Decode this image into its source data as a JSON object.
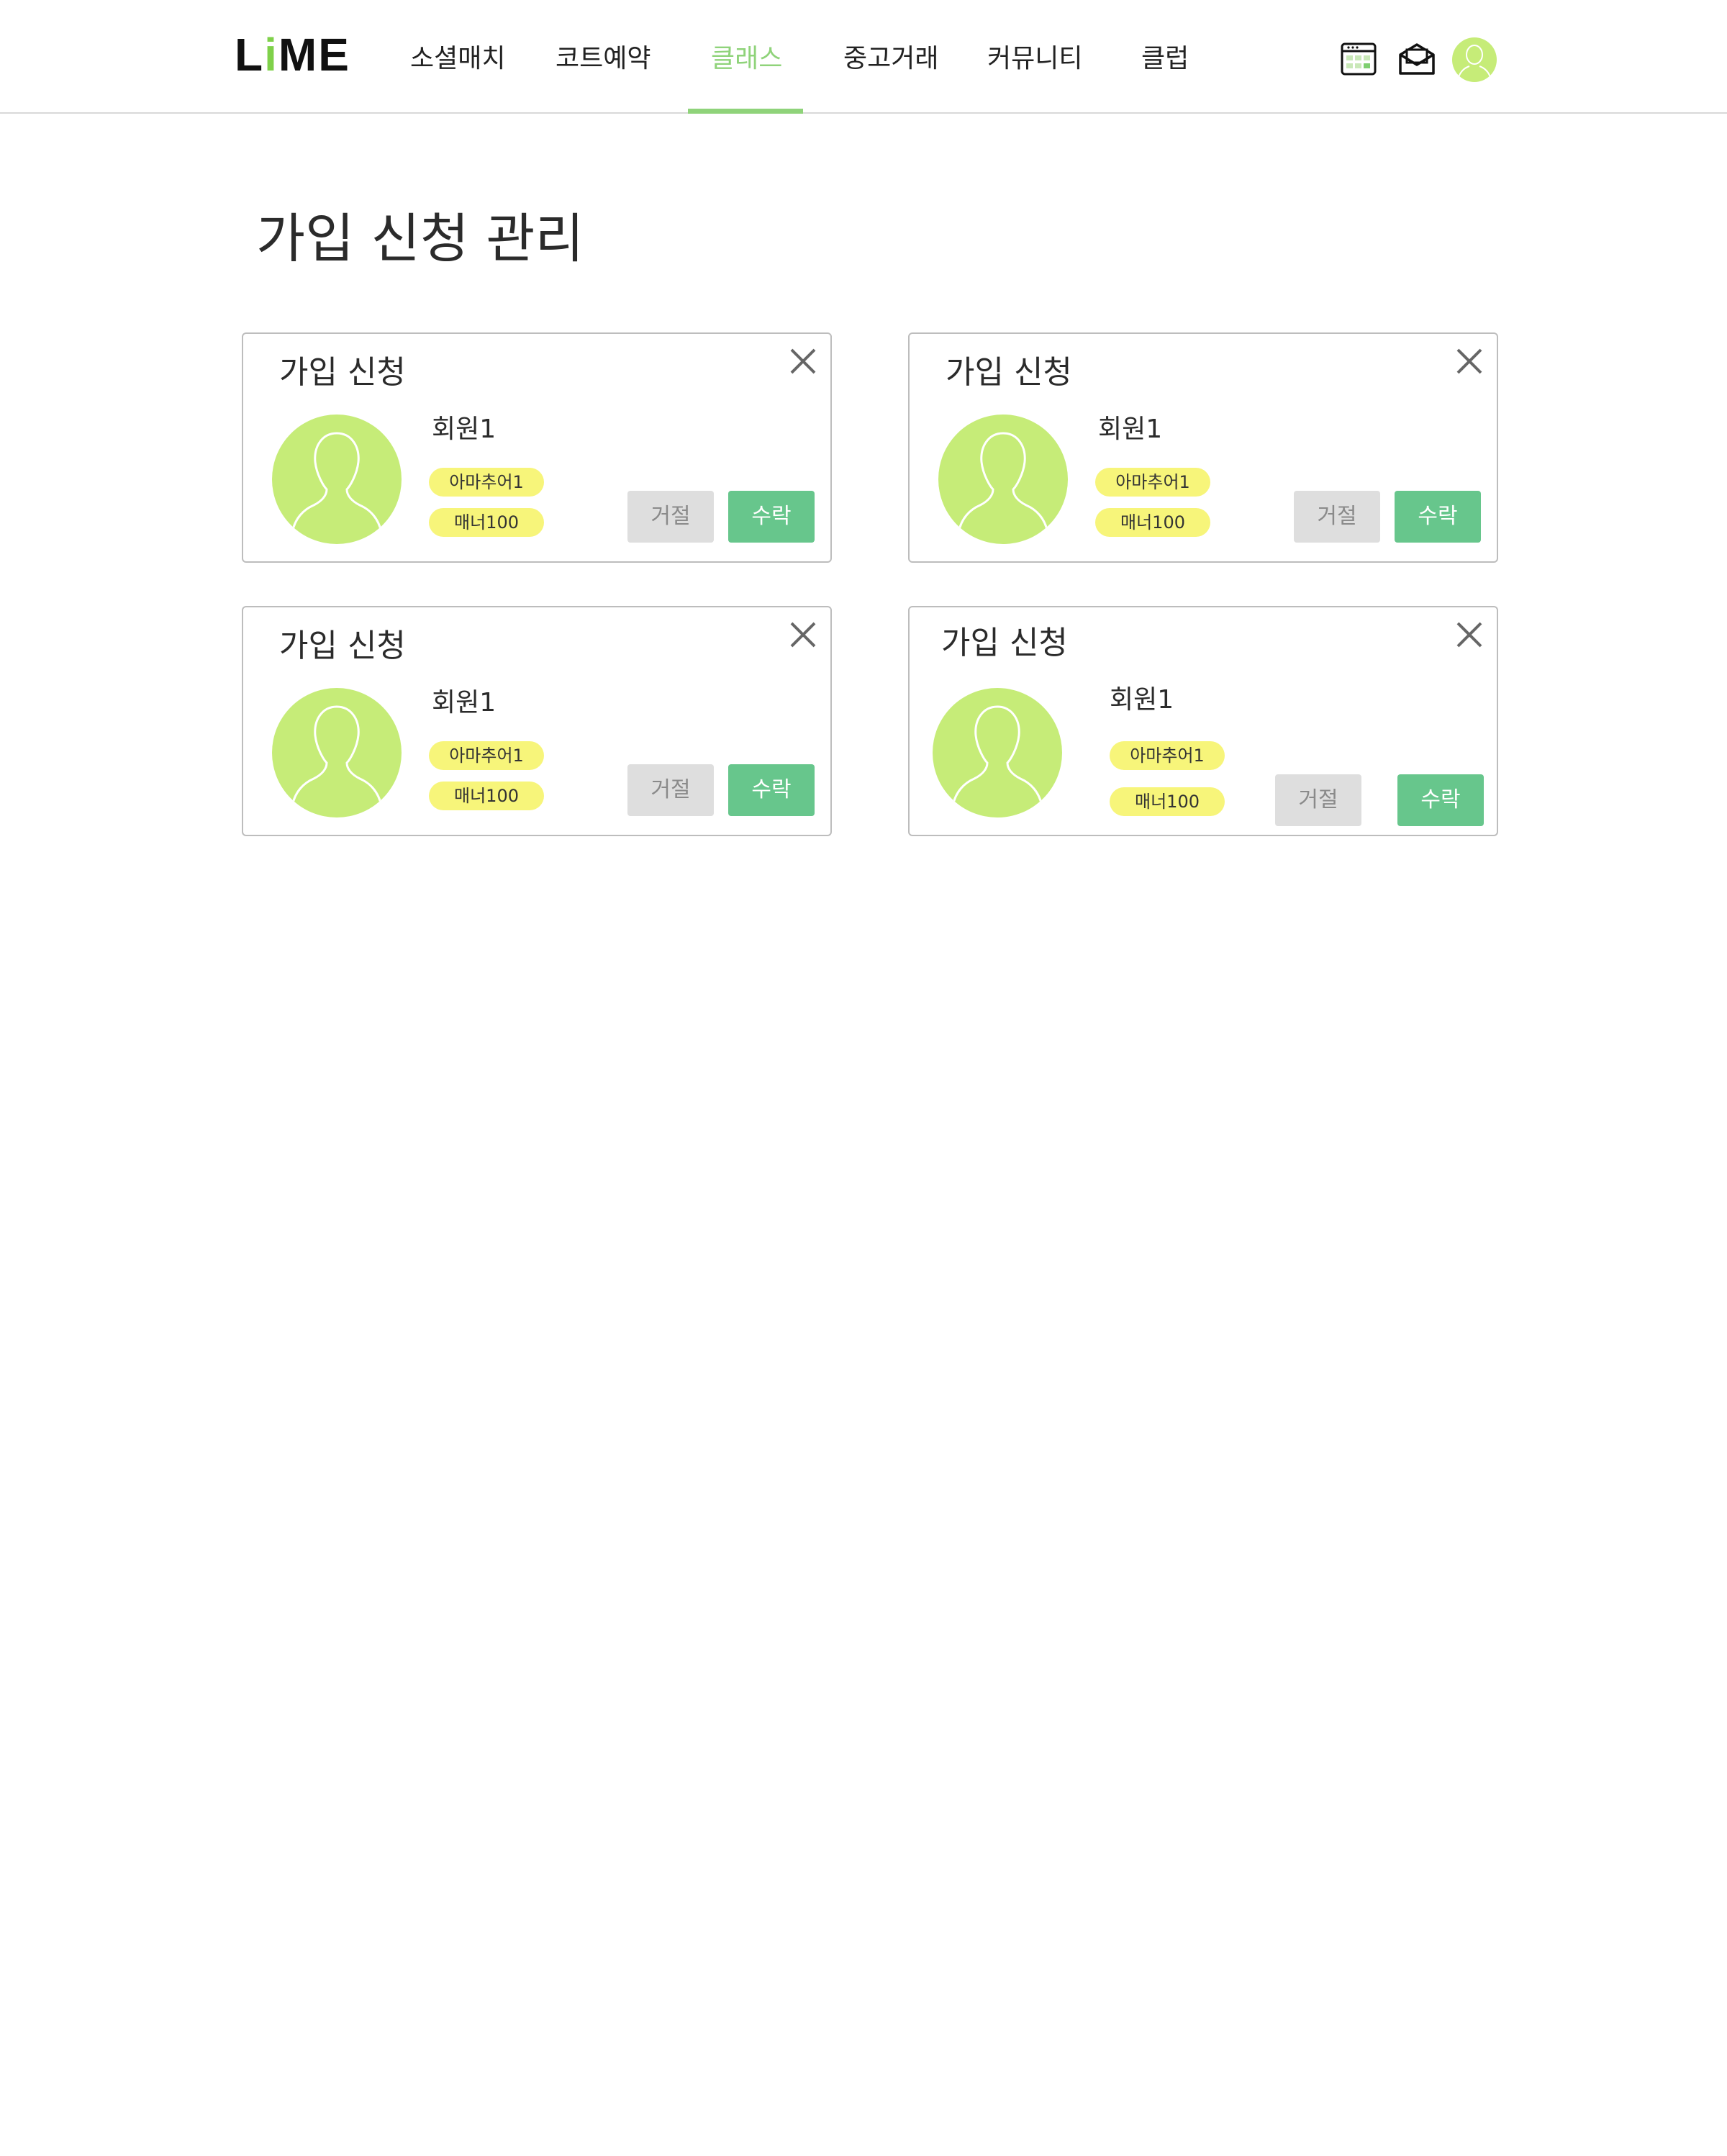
{
  "header": {
    "logo": {
      "prefix": "L",
      "accent": "i",
      "suffix": "ME"
    },
    "nav": [
      {
        "label": "소셜매치",
        "active": false
      },
      {
        "label": "코트예약",
        "active": false
      },
      {
        "label": "클래스",
        "active": true
      },
      {
        "label": "중고거래",
        "active": false
      },
      {
        "label": "커뮤니티",
        "active": false
      },
      {
        "label": "클럽",
        "active": false
      }
    ],
    "icons": [
      "calendar-icon",
      "mail-icon",
      "profile-avatar"
    ]
  },
  "page": {
    "title": "가입 신청 관리"
  },
  "cards": [
    {
      "title": "가입 신청",
      "member_name": "회원1",
      "badge_level": "아마추어1",
      "badge_manner": "매너100",
      "reject_label": "거절",
      "accept_label": "수락"
    },
    {
      "title": "가입 신청",
      "member_name": "회원1",
      "badge_level": "아마추어1",
      "badge_manner": "매너100",
      "reject_label": "거절",
      "accept_label": "수락"
    },
    {
      "title": "가입 신청",
      "member_name": "회원1",
      "badge_level": "아마추어1",
      "badge_manner": "매너100",
      "reject_label": "거절",
      "accept_label": "수락"
    },
    {
      "title": "가입 신청",
      "member_name": "회원1",
      "badge_level": "아마추어1",
      "badge_manner": "매너100",
      "reject_label": "거절",
      "accept_label": "수락"
    }
  ],
  "colors": {
    "accent_green": "#8fd37a",
    "avatar_green": "#c6ec78",
    "badge_yellow": "#f7f57a",
    "accept_green": "#67c68c",
    "reject_gray": "#dedede"
  }
}
